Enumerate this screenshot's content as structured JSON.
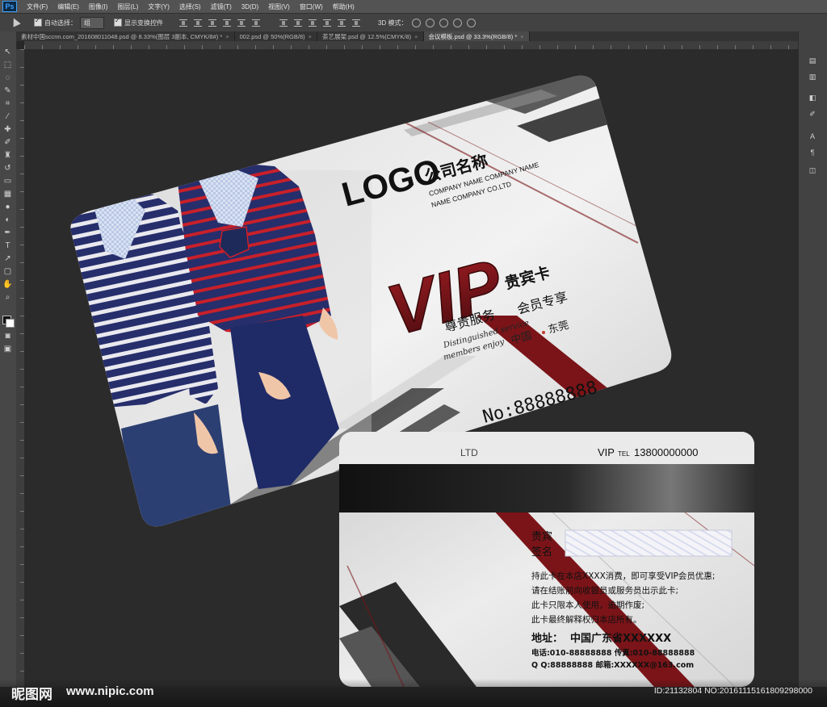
{
  "app": {
    "logo": "Ps",
    "menu": [
      "文件(F)",
      "编辑(E)",
      "图像(I)",
      "图层(L)",
      "文字(Y)",
      "选择(S)",
      "滤镜(T)",
      "3D(D)",
      "视图(V)",
      "窗口(W)",
      "帮助(H)"
    ]
  },
  "options": {
    "auto_select_label": "自动选择：",
    "auto_select_value": "组",
    "show_transform_label": "显示变换控件",
    "mode3d_label": "3D 模式："
  },
  "tabs": [
    {
      "label": "素材中国sccnn.com_201608011048.psd @ 8.33%(图层 3副本, CMYK/8#) *",
      "active": false
    },
    {
      "label": "002.psd @ 50%(RGB/8)",
      "active": false
    },
    {
      "label": "茶艺展架.psd @ 12.5%(CMYK/8)",
      "active": false
    },
    {
      "label": "会议模板.psd @ 33.3%(RGB/8) *",
      "active": true
    }
  ],
  "front_card": {
    "logo": "LOGO",
    "company_name": "公司名称",
    "company_en_1": "COMPANY NAME COMPANY NAME",
    "company_en_2": "NAME COMPANY CO.LTD",
    "vip": "VIP",
    "vip_title": "贵宾卡",
    "service_1": "尊贵服务",
    "service_2": "会员专享",
    "script_1": "Distinguished service",
    "script_2": "members enjoy",
    "location_1": "中国",
    "location_2": "东莞",
    "card_no": "No:88888888"
  },
  "back_card": {
    "header_left": "LTD",
    "header_vip": "VIP",
    "header_tel_label": "TEL",
    "header_tel": "13800000000",
    "sign_label_1": "贵宾",
    "sign_label_2": "签名",
    "rules": [
      "持此卡在本店XXXX消费，即可享受VIP会员优惠;",
      "请在结账前向收银员或服务员出示此卡;",
      "此卡只限本人使用，逾期作废;",
      "此卡最终解释权归本店所有。"
    ],
    "address_label": "地址：",
    "address_value": "中国广东省XXXXXX",
    "phone_line": "电话:010-88888888  传真:010-88888888",
    "qq_line": "Q Q:88888888  邮箱:XXXXXX@163.com"
  },
  "watermark": {
    "site_cn": "昵图网",
    "site_url": "www.nipic.com",
    "id_text": "ID:21132804 NO:20161115161809298000"
  },
  "colors": {
    "accent_red": "#7a1418",
    "ps_bg": "#282828"
  }
}
